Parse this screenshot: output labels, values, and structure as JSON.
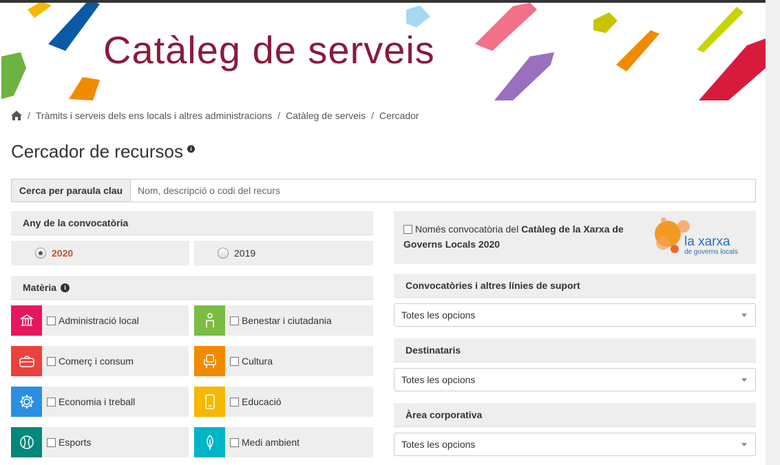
{
  "banner": {
    "title": "Catàleg de serveis"
  },
  "breadcrumb": {
    "items": [
      "Tràmits i serveis dels ens locals i altres administracions",
      "Catàleg de serveis",
      "Cercador"
    ]
  },
  "page": {
    "title": "Cercador de recursos",
    "info": "i"
  },
  "search": {
    "label": "Cerca per paraula clau",
    "placeholder": "Nom, descripció o codi del recurs"
  },
  "year": {
    "header": "Any de la convocatòria",
    "options": [
      {
        "label": "2020",
        "checked": true
      },
      {
        "label": "2019",
        "checked": false
      }
    ]
  },
  "materia": {
    "header": "Matèria",
    "items": [
      {
        "label": "Administració local",
        "color": "#e6175c"
      },
      {
        "label": "Benestar i ciutadania",
        "color": "#7bbd42"
      },
      {
        "label": "Comerç i consum",
        "color": "#e9423c"
      },
      {
        "label": "Cultura",
        "color": "#f28a00"
      },
      {
        "label": "Economia i treball",
        "color": "#2a8fe0"
      },
      {
        "label": "Educació",
        "color": "#f6b800"
      },
      {
        "label": "Esports",
        "color": "#00897b"
      },
      {
        "label": "Medi ambient",
        "color": "#00b5c8"
      }
    ]
  },
  "xarxa": {
    "text_prefix": "Només convocatòria del ",
    "text_bold": "Catàleg de la Xarxa de Governs Locals 2020",
    "logo_main": "la xarxa",
    "logo_sub": "de governs locals"
  },
  "filters": [
    {
      "header": "Convocatòries i altres línies de suport",
      "value": "Totes les opcions"
    },
    {
      "header": "Destinataris",
      "value": "Totes les opcions"
    },
    {
      "header": "Àrea corporativa",
      "value": "Totes les opcions"
    }
  ]
}
